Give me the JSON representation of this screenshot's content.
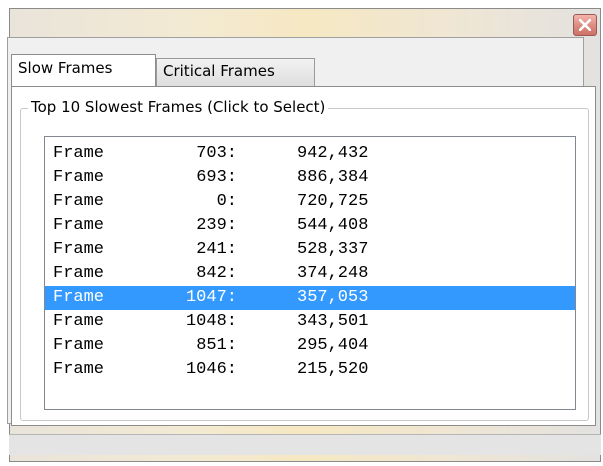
{
  "window": {
    "close_icon": "close-x-icon"
  },
  "tabs": [
    {
      "label": "Slow Frames",
      "active": true
    },
    {
      "label": "Critical Frames",
      "active": false
    }
  ],
  "group": {
    "title": "Top 10 Slowest Frames (Click to Select)"
  },
  "frames": [
    {
      "label": "Frame",
      "number": "703:",
      "value": "942,432",
      "selected": false
    },
    {
      "label": "Frame",
      "number": "693:",
      "value": "886,384",
      "selected": false
    },
    {
      "label": "Frame",
      "number": "0:",
      "value": "720,725",
      "selected": false
    },
    {
      "label": "Frame",
      "number": "239:",
      "value": "544,408",
      "selected": false
    },
    {
      "label": "Frame",
      "number": "241:",
      "value": "528,337",
      "selected": false
    },
    {
      "label": "Frame",
      "number": "842:",
      "value": "374,248",
      "selected": false
    },
    {
      "label": "Frame",
      "number": "1047:",
      "value": "357,053",
      "selected": true
    },
    {
      "label": "Frame",
      "number": "1048:",
      "value": "343,501",
      "selected": false
    },
    {
      "label": "Frame",
      "number": "851:",
      "value": "295,404",
      "selected": false
    },
    {
      "label": "Frame",
      "number": "1046:",
      "value": "215,520",
      "selected": false
    }
  ],
  "colors": {
    "selection": "#3399ff",
    "close_button": "#dc8a80"
  }
}
